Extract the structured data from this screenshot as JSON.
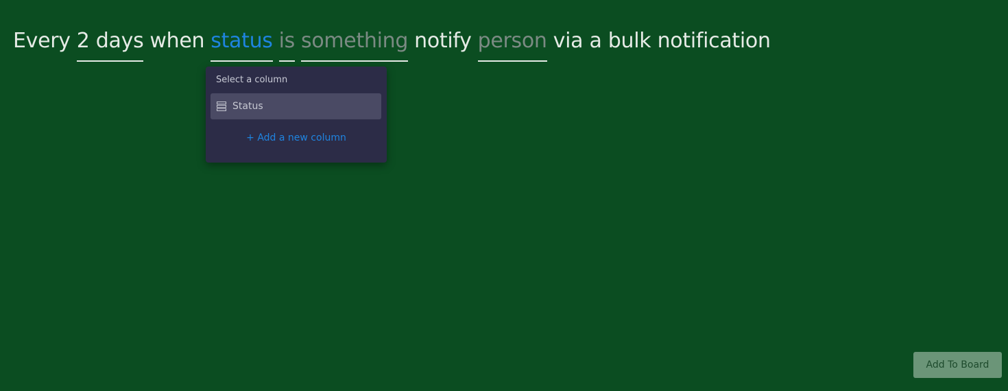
{
  "recipe": {
    "every": "Every",
    "interval": "2 days",
    "when": "when",
    "column": "status",
    "condition": "is",
    "value": "something",
    "notify": "notify",
    "recipient": "person",
    "tail": "via a bulk notification"
  },
  "dropdown": {
    "title": "Select a column",
    "options": [
      {
        "label": "Status",
        "icon": "status-column-icon"
      }
    ],
    "add_link": "+ Add a new column"
  },
  "actions": {
    "add_to_board": "Add To Board"
  },
  "colors": {
    "background": "#0b4d21",
    "accent": "#1f84e0",
    "dropdown_bg": "#2c2c47",
    "button_bg": "#6b9578"
  }
}
